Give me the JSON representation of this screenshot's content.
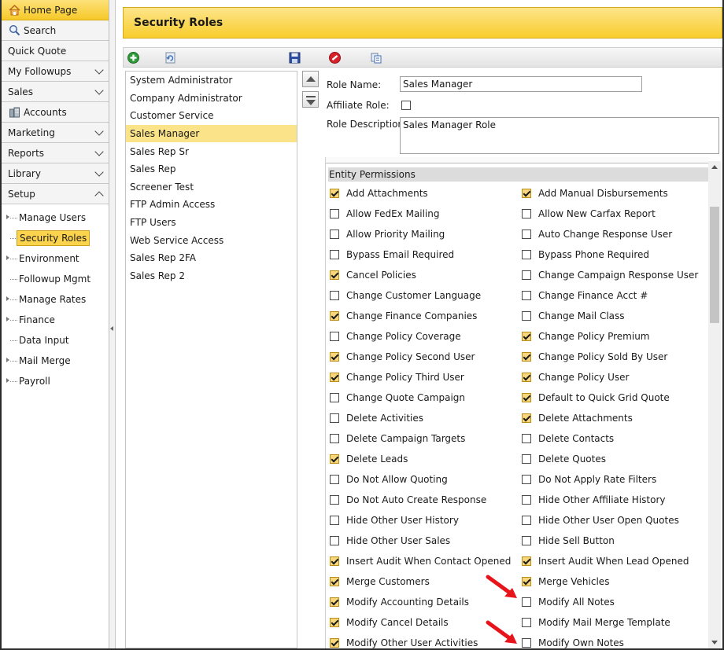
{
  "sidebar": {
    "items": [
      {
        "label": "Home Page",
        "icon": "home-icon",
        "expandable": false,
        "active": true
      },
      {
        "label": "Search",
        "icon": "search-icon",
        "expandable": false
      },
      {
        "label": "Quick Quote",
        "icon": "",
        "expandable": false
      },
      {
        "label": "My Followups",
        "icon": "",
        "expandable": true
      },
      {
        "label": "Sales",
        "icon": "",
        "expandable": true
      },
      {
        "label": "Accounts",
        "icon": "building-icon",
        "expandable": false
      },
      {
        "label": "Marketing",
        "icon": "",
        "expandable": true
      },
      {
        "label": "Reports",
        "icon": "",
        "expandable": true
      },
      {
        "label": "Library",
        "icon": "",
        "expandable": true
      },
      {
        "label": "Setup",
        "icon": "",
        "expandable": true,
        "expanded": true
      }
    ],
    "setup_children": [
      {
        "label": "Manage Users",
        "has_children": true
      },
      {
        "label": "Security Roles",
        "has_children": false,
        "selected": true
      },
      {
        "label": "Environment",
        "has_children": true
      },
      {
        "label": "Followup Mgmt",
        "has_children": false
      },
      {
        "label": "Manage Rates",
        "has_children": true
      },
      {
        "label": "Finance",
        "has_children": true
      },
      {
        "label": "Data Input",
        "has_children": false
      },
      {
        "label": "Mail Merge",
        "has_children": true
      },
      {
        "label": "Payroll",
        "has_children": true
      }
    ]
  },
  "page": {
    "title": "Security Roles"
  },
  "toolbar": {
    "buttons": [
      "add-icon",
      "refresh-icon",
      "save-icon",
      "delete-icon",
      "copy-icon"
    ]
  },
  "roles": [
    {
      "name": "System Administrator"
    },
    {
      "name": "Company Administrator"
    },
    {
      "name": "Customer Service"
    },
    {
      "name": "Sales Manager",
      "selected": true
    },
    {
      "name": "Sales Rep Sr"
    },
    {
      "name": "Sales Rep"
    },
    {
      "name": "Screener Test"
    },
    {
      "name": "FTP Admin Access"
    },
    {
      "name": "FTP Users"
    },
    {
      "name": "Web Service Access"
    },
    {
      "name": "Sales Rep 2FA"
    },
    {
      "name": "Sales Rep 2"
    }
  ],
  "form": {
    "role_name_label": "Role Name:",
    "role_name_value": "Sales Manager",
    "affiliate_label": "Affiliate Role:",
    "affiliate_checked": false,
    "description_label": "Role Description:",
    "description_value": "Sales Manager Role"
  },
  "permissions": {
    "section_title": "Entity Permissions",
    "rows": [
      [
        {
          "label": "Add Attachments",
          "checked": true
        },
        {
          "label": "Add Manual Disbursements",
          "checked": true
        }
      ],
      [
        {
          "label": "Allow FedEx Mailing",
          "checked": false
        },
        {
          "label": "Allow New Carfax Report",
          "checked": false
        }
      ],
      [
        {
          "label": "Allow Priority Mailing",
          "checked": false
        },
        {
          "label": "Auto Change Response User",
          "checked": false
        }
      ],
      [
        {
          "label": "Bypass Email Required",
          "checked": false
        },
        {
          "label": "Bypass Phone Required",
          "checked": false
        }
      ],
      [
        {
          "label": "Cancel Policies",
          "checked": true
        },
        {
          "label": "Change Campaign Response User",
          "checked": false
        }
      ],
      [
        {
          "label": "Change Customer Language",
          "checked": false
        },
        {
          "label": "Change Finance Acct #",
          "checked": false
        }
      ],
      [
        {
          "label": "Change Finance Companies",
          "checked": true
        },
        {
          "label": "Change Mail Class",
          "checked": false
        }
      ],
      [
        {
          "label": "Change Policy Coverage",
          "checked": false
        },
        {
          "label": "Change Policy Premium",
          "checked": true
        }
      ],
      [
        {
          "label": "Change Policy Second User",
          "checked": true
        },
        {
          "label": "Change Policy Sold By User",
          "checked": true
        }
      ],
      [
        {
          "label": "Change Policy Third User",
          "checked": true
        },
        {
          "label": "Change Policy User",
          "checked": true
        }
      ],
      [
        {
          "label": "Change Quote Campaign",
          "checked": false
        },
        {
          "label": "Default to Quick Grid Quote",
          "checked": true
        }
      ],
      [
        {
          "label": "Delete Activities",
          "checked": false
        },
        {
          "label": "Delete Attachments",
          "checked": true
        }
      ],
      [
        {
          "label": "Delete Campaign Targets",
          "checked": false
        },
        {
          "label": "Delete Contacts",
          "checked": false
        }
      ],
      [
        {
          "label": "Delete Leads",
          "checked": true
        },
        {
          "label": "Delete Quotes",
          "checked": false
        }
      ],
      [
        {
          "label": "Do Not Allow Quoting",
          "checked": false
        },
        {
          "label": "Do Not Apply Rate Filters",
          "checked": false
        }
      ],
      [
        {
          "label": "Do Not Auto Create Response",
          "checked": false
        },
        {
          "label": "Hide Other Affiliate History",
          "checked": false
        }
      ],
      [
        {
          "label": "Hide Other User History",
          "checked": false
        },
        {
          "label": "Hide Other User Open Quotes",
          "checked": false
        }
      ],
      [
        {
          "label": "Hide Other User Sales",
          "checked": false
        },
        {
          "label": "Hide Sell Button",
          "checked": false
        }
      ],
      [
        {
          "label": "Insert Audit When Contact Opened",
          "checked": true
        },
        {
          "label": "Insert Audit When Lead Opened",
          "checked": true
        }
      ],
      [
        {
          "label": "Merge Customers",
          "checked": true
        },
        {
          "label": "Merge Vehicles",
          "checked": true
        }
      ],
      [
        {
          "label": "Modify Accounting Details",
          "checked": true
        },
        {
          "label": "Modify All Notes",
          "checked": false
        }
      ],
      [
        {
          "label": "Modify Cancel Details",
          "checked": true
        },
        {
          "label": "Modify Mail Merge Template",
          "checked": false
        }
      ],
      [
        {
          "label": "Modify Other User Activities",
          "checked": true
        },
        {
          "label": "Modify Own Notes",
          "checked": false
        }
      ]
    ]
  },
  "colors": {
    "accent": "#f8cd2c",
    "selected_row": "#fbe38a",
    "annotation_arrow": "#e8141c"
  }
}
